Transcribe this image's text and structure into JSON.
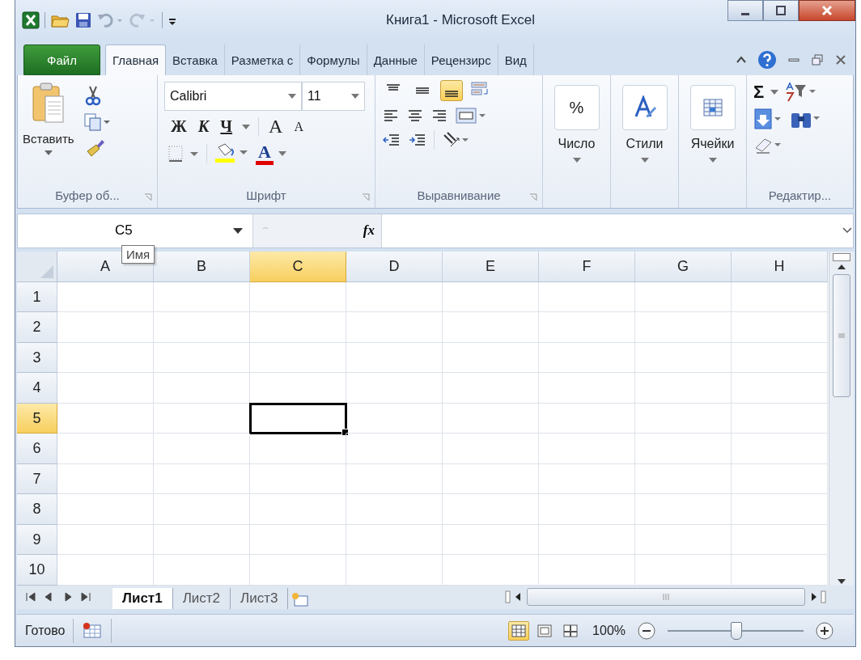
{
  "window": {
    "title": "Книга1  -  Microsoft Excel"
  },
  "ribbon_tabs": [
    {
      "label": "Файл",
      "kind": "file",
      "selected": false
    },
    {
      "label": "Главная",
      "kind": "tab",
      "selected": true
    },
    {
      "label": "Вставка",
      "kind": "tab",
      "selected": false
    },
    {
      "label": "Разметка с",
      "kind": "tab",
      "selected": false
    },
    {
      "label": "Формулы",
      "kind": "tab",
      "selected": false
    },
    {
      "label": "Данные",
      "kind": "tab",
      "selected": false
    },
    {
      "label": "Рецензирс",
      "kind": "tab",
      "selected": false
    },
    {
      "label": "Вид",
      "kind": "tab",
      "selected": false
    }
  ],
  "clipboard": {
    "paste_label": "Вставить",
    "group_label": "Буфер об..."
  },
  "font": {
    "name": "Calibri",
    "size": "11",
    "bold": "Ж",
    "italic": "К",
    "underline": "Ч",
    "grow": "A",
    "shrink": "A",
    "color_letter": "A",
    "group_label": "Шрифт"
  },
  "alignment": {
    "vertical": [
      {
        "kind": "top",
        "selected": false
      },
      {
        "kind": "middle",
        "selected": false
      },
      {
        "kind": "bottom",
        "selected": true
      }
    ],
    "group_label": "Выравнивание"
  },
  "big_groups": [
    {
      "kind": "number",
      "symbol": "%",
      "label": "Число"
    },
    {
      "kind": "styles",
      "label": "Стили"
    },
    {
      "kind": "cells",
      "label": "Ячейки"
    }
  ],
  "editing": {
    "sum": "Σ",
    "group_label": "Редактир..."
  },
  "formula_bar": {
    "name_box": "C5",
    "fx": "fx",
    "tooltip": "Имя"
  },
  "columns": [
    {
      "label": "A",
      "selected": false
    },
    {
      "label": "B",
      "selected": false
    },
    {
      "label": "C",
      "selected": true
    },
    {
      "label": "D",
      "selected": false
    },
    {
      "label": "E",
      "selected": false
    },
    {
      "label": "F",
      "selected": false
    },
    {
      "label": "G",
      "selected": false
    },
    {
      "label": "H",
      "selected": false
    }
  ],
  "rows": [
    {
      "label": "1",
      "selected": false
    },
    {
      "label": "2",
      "selected": false
    },
    {
      "label": "3",
      "selected": false
    },
    {
      "label": "4",
      "selected": false
    },
    {
      "label": "5",
      "selected": true
    },
    {
      "label": "6",
      "selected": false
    },
    {
      "label": "7",
      "selected": false
    },
    {
      "label": "8",
      "selected": false
    },
    {
      "label": "9",
      "selected": false
    },
    {
      "label": "10",
      "selected": false
    }
  ],
  "sheet_tabs": [
    {
      "label": "Лист1",
      "selected": true
    },
    {
      "label": "Лист2",
      "selected": false
    },
    {
      "label": "Лист3",
      "selected": false
    }
  ],
  "status_bar": {
    "status": "Готово",
    "views": [
      {
        "kind": "normal",
        "selected": true
      },
      {
        "kind": "layout",
        "selected": false
      },
      {
        "kind": "break",
        "selected": false
      }
    ],
    "zoom": "100%",
    "zoom_slider": {
      "level": 0.5
    }
  }
}
